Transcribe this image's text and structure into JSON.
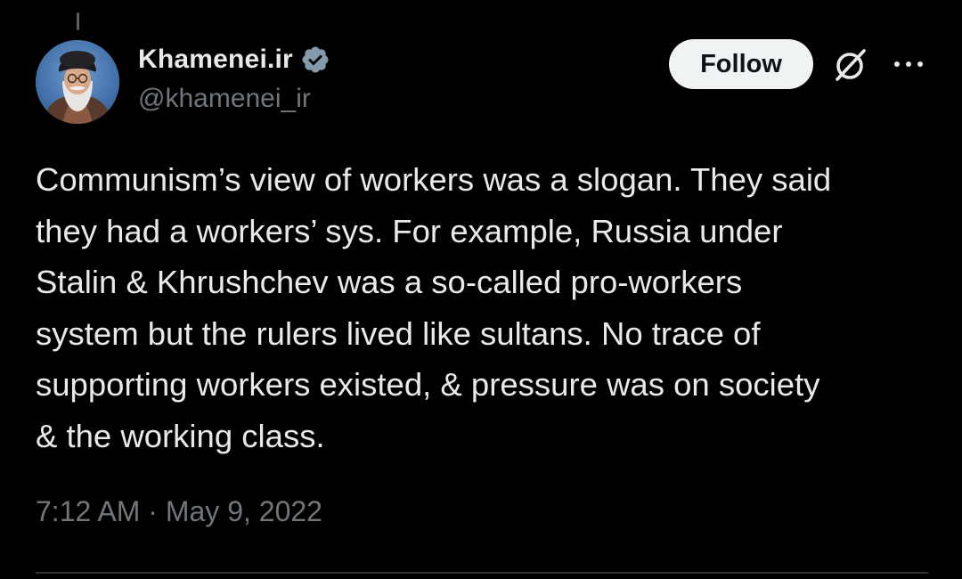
{
  "tweet": {
    "display_name": "Khamenei.ir",
    "handle": "@khamenei_ir",
    "verified": true,
    "follow_label": "Follow",
    "text": "Communism’s view of workers was a slogan. They said\nthey had a workers’ sys. For example, Russia under\nStalin & Khrushchev was a so-called pro-workers\nsystem but the rulers lived like sultans. No trace of\nsupporting workers existed, & pressure was on society\n& the working class.",
    "timestamp": "7:12 AM · May 9, 2022"
  },
  "icons": {
    "verified": "verified-badge-icon",
    "grok": "grok-icon",
    "more": "more-options-icon"
  },
  "colors": {
    "background": "#000000",
    "primary_text": "#e7e9ea",
    "secondary_text": "#71767b",
    "follow_bg": "#eff3f4",
    "follow_text": "#0f1419",
    "verified_badge": "#829aab",
    "divider": "#2f3336"
  }
}
